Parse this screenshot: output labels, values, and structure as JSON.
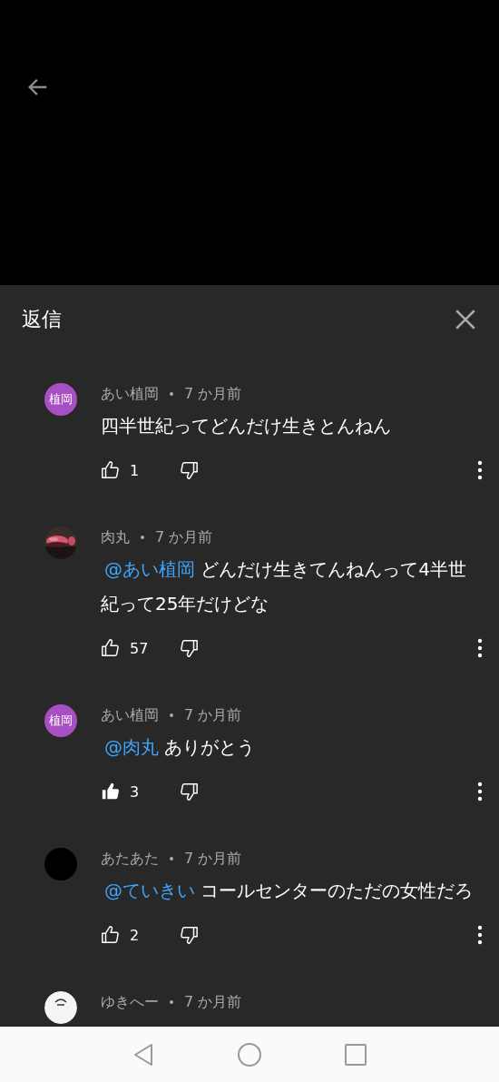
{
  "header": {
    "title": "返信"
  },
  "comments": [
    {
      "author": "あい植岡",
      "time": "7 か月前",
      "avatar": {
        "kind": "initials",
        "label": "植岡",
        "color": "#a94fc4"
      },
      "text": "四半世紀ってどんだけ生きとんねん",
      "likes": "1",
      "liked": false
    },
    {
      "author": "肉丸",
      "time": "7 か月前",
      "mention": "@あい植岡",
      "text": "どんだけ生きてんねんって4半世紀って25年だけどな",
      "likes": "57",
      "liked": false
    },
    {
      "author": "あい植岡",
      "time": "7 か月前",
      "avatar": {
        "kind": "initials",
        "label": "植岡",
        "color": "#a94fc4"
      },
      "mention": "@肉丸",
      "text": "ありがとう",
      "likes": "3",
      "liked": true
    },
    {
      "author": "あたあた",
      "time": "7 か月前",
      "avatar": {
        "kind": "plain",
        "color": "#000000"
      },
      "mention": "@ていきい",
      "text": "コールセンターのただの女性だろ",
      "likes": "2",
      "liked": false
    },
    {
      "author": "ゆきへー",
      "time": "7 か月前",
      "avatar": {
        "kind": "sketch"
      }
    }
  ]
}
